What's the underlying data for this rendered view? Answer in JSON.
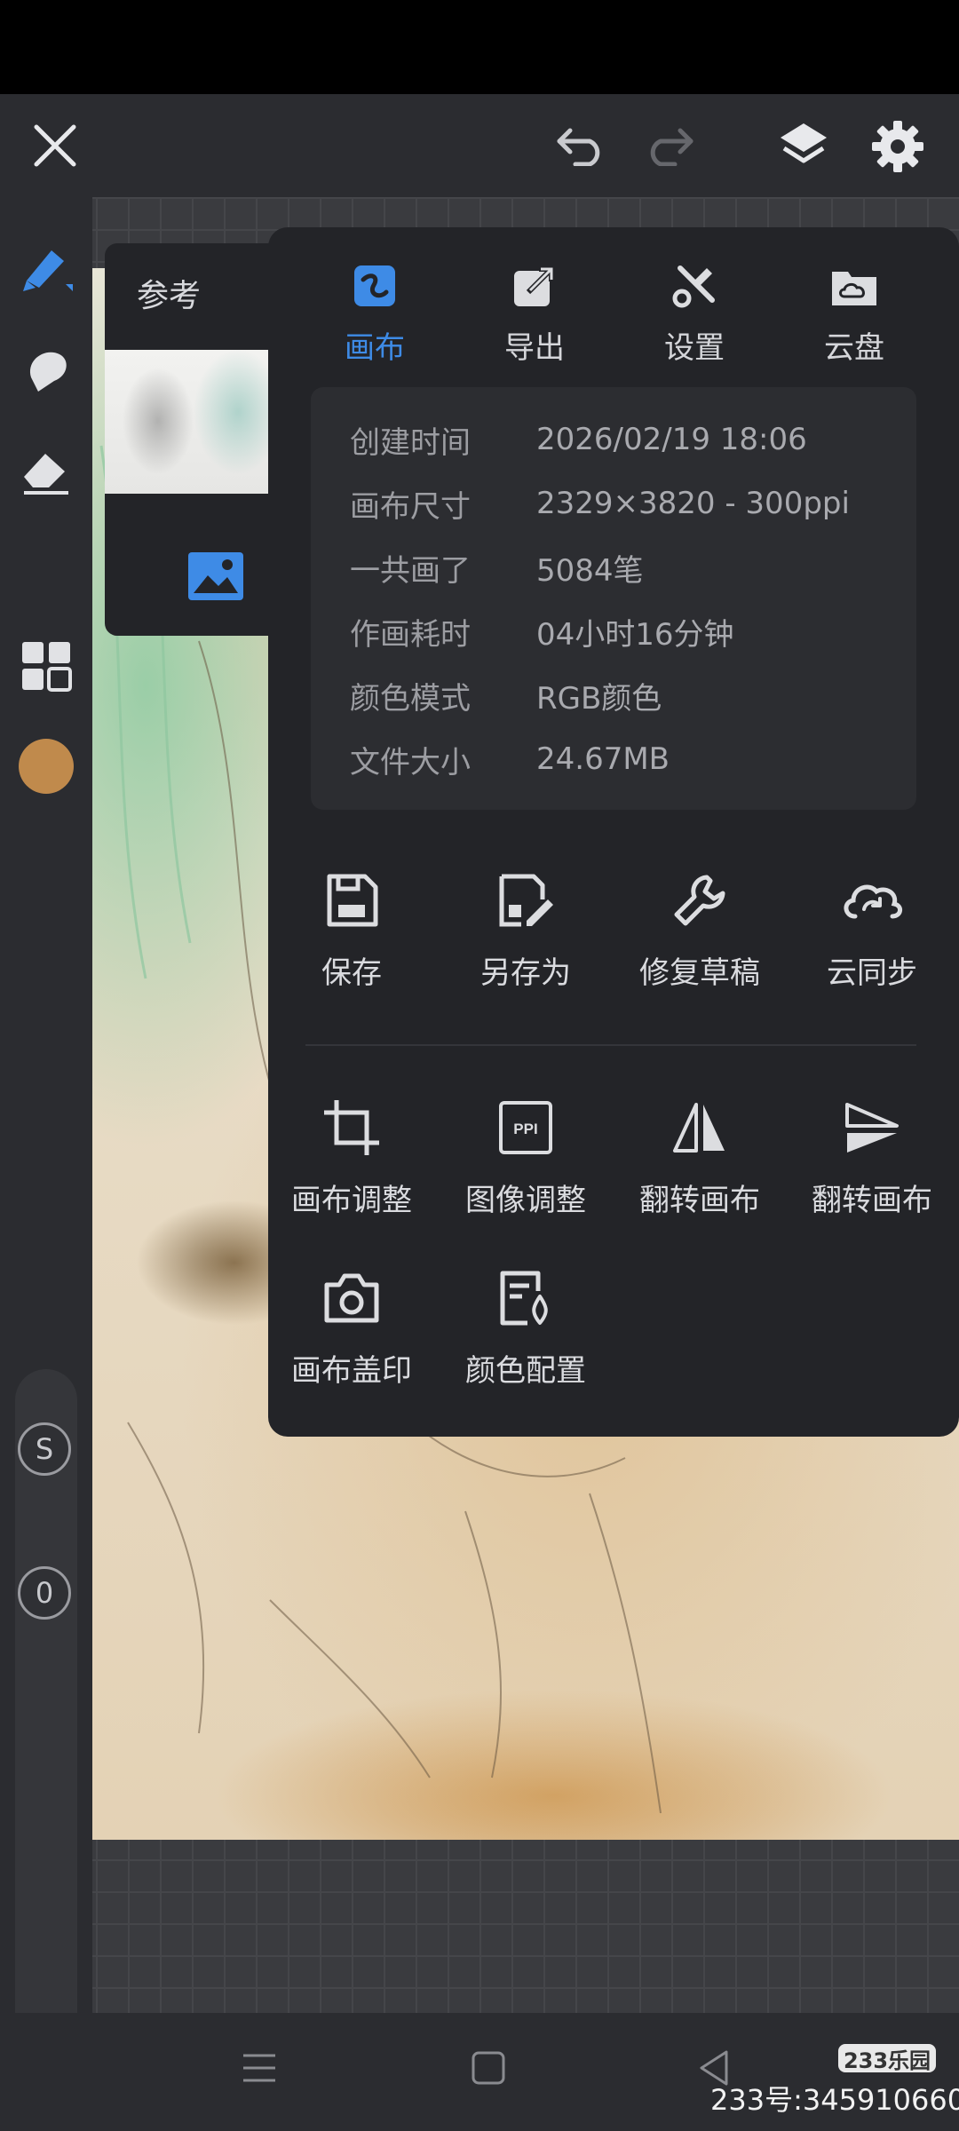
{
  "top_bar": {
    "close_icon": "close-icon",
    "undo_icon": "undo-icon",
    "redo_icon": "redo-icon",
    "layers_icon": "layers-icon",
    "settings_icon": "gear-icon"
  },
  "left_toolbar": {
    "tools": [
      "brush-icon",
      "smudge-icon",
      "eraser-icon",
      "color-swatch",
      "grid-icon"
    ],
    "brush_color": "#c08a4c",
    "size_badge": "S",
    "opacity_badge": "0"
  },
  "reference_panel": {
    "title": "参考",
    "image_icon": "image-icon"
  },
  "menu": {
    "tabs": [
      {
        "label": "画布",
        "icon": "canvas-icon",
        "active": true
      },
      {
        "label": "导出",
        "icon": "export-icon",
        "active": false
      },
      {
        "label": "设置",
        "icon": "tools-icon",
        "active": false
      },
      {
        "label": "云盘",
        "icon": "cloud-folder-icon",
        "active": false
      }
    ],
    "info": [
      {
        "key": "创建时间",
        "value": "2026/02/19 18:06"
      },
      {
        "key": "画布尺寸",
        "value": "2329×3820 - 300ppi"
      },
      {
        "key": "一共画了",
        "value": "5084笔"
      },
      {
        "key": "作画耗时",
        "value": "04小时16分钟"
      },
      {
        "key": "颜色模式",
        "value": "RGB颜色"
      },
      {
        "key": "文件大小",
        "value": "24.67MB"
      }
    ],
    "primary_actions": [
      {
        "label": "保存",
        "icon": "save-icon"
      },
      {
        "label": "另存为",
        "icon": "save-as-icon"
      },
      {
        "label": "修复草稿",
        "icon": "wrench-icon"
      },
      {
        "label": "云同步",
        "icon": "cloud-sync-icon"
      }
    ],
    "canvas_actions": [
      {
        "label": "画布调整",
        "icon": "crop-icon"
      },
      {
        "label": "图像调整",
        "icon": "ppi-icon",
        "icon_text": "PPI"
      },
      {
        "label": "翻转画布",
        "icon": "flip-horizontal-icon"
      },
      {
        "label": "翻转画布",
        "icon": "flip-vertical-icon"
      },
      {
        "label": "画布盖印",
        "icon": "camera-icon"
      },
      {
        "label": "颜色配置",
        "icon": "color-profile-icon"
      }
    ]
  },
  "accent_color": "#3e8be6",
  "watermark": {
    "logo": "233乐园",
    "text": "233号:345910660"
  }
}
